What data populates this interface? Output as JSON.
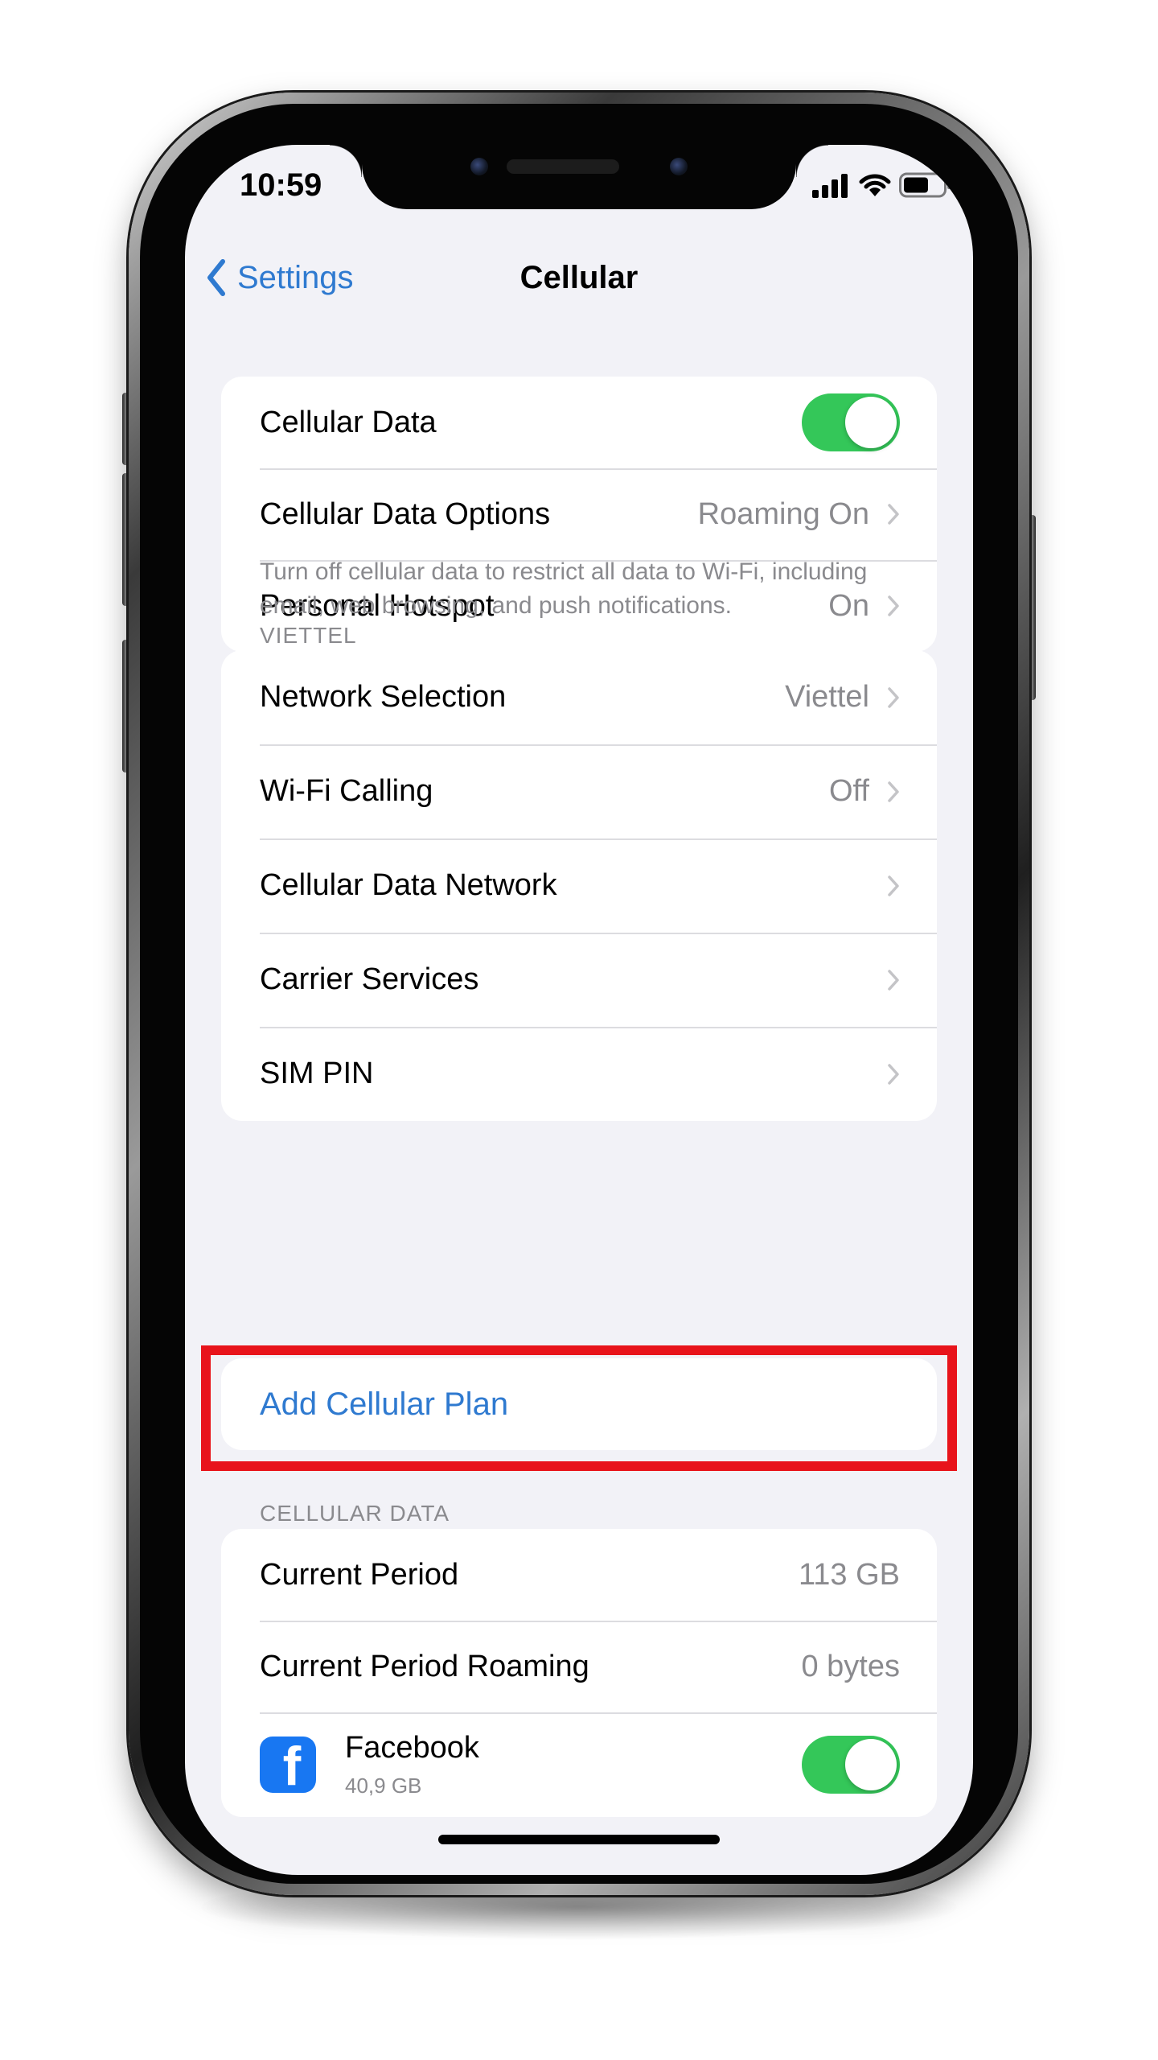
{
  "status_bar": {
    "time": "10:59"
  },
  "nav": {
    "back_label": "Settings",
    "title": "Cellular"
  },
  "group1": {
    "cellular_data": {
      "label": "Cellular Data",
      "on": true
    },
    "data_options": {
      "label": "Cellular Data Options",
      "value": "Roaming On"
    },
    "hotspot": {
      "label": "Personal Hotspot",
      "value": "On"
    }
  },
  "group1_footer": "Turn off cellular data to restrict all data to Wi-Fi, including email, web browsing, and push notifications.",
  "carrier": {
    "header": "VIETTEL",
    "items": [
      {
        "label": "Network Selection",
        "value": "Viettel"
      },
      {
        "label": "Wi-Fi Calling",
        "value": "Off"
      },
      {
        "label": "Cellular Data Network",
        "value": ""
      },
      {
        "label": "Carrier Services",
        "value": ""
      },
      {
        "label": "SIM PIN",
        "value": ""
      }
    ]
  },
  "add_plan": {
    "label": "Add Cellular Plan"
  },
  "usage": {
    "header": "CELLULAR DATA",
    "current_period": {
      "label": "Current Period",
      "value": "113 GB"
    },
    "current_period_roaming": {
      "label": "Current Period Roaming",
      "value": "0 bytes"
    },
    "apps": [
      {
        "name": "Facebook",
        "size": "40,9 GB",
        "on": true,
        "icon": "facebook-icon"
      }
    ]
  },
  "colors": {
    "accent": "#2f7ad0",
    "toggle_on": "#34c759",
    "highlight": "#e8141b",
    "background": "#f2f2f7",
    "facebook": "#1877f2"
  }
}
